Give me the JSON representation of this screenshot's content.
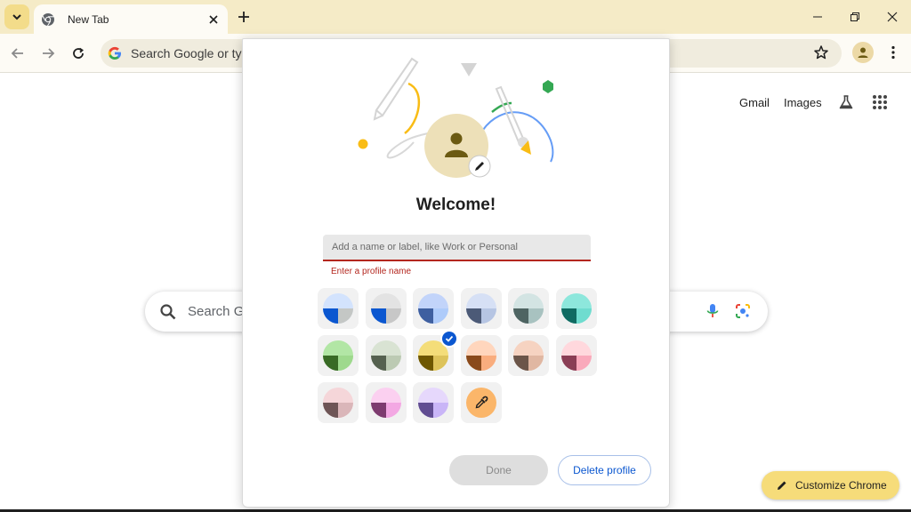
{
  "browser": {
    "tab_title": "New Tab",
    "omnibox_text": "Search Google or type",
    "accent_color": "#f5ebc7"
  },
  "ntp": {
    "links": [
      "Gmail",
      "Images"
    ],
    "search_placeholder": "Search G",
    "customize_label": "Customize Chrome"
  },
  "dialog": {
    "title": "Welcome!",
    "name_field": {
      "value": "",
      "placeholder": "Add a name or label, like Work or Personal"
    },
    "error_text": "Enter a profile name",
    "themes": [
      {
        "name": "theme-blue-1",
        "top": "#d3e3fd",
        "left": "#0b57d0",
        "right": "#c4c7c5"
      },
      {
        "name": "theme-grey-blue",
        "top": "#e3e3e3",
        "left": "#0b57d0",
        "right": "#c7c7c7"
      },
      {
        "name": "theme-blue-2",
        "top": "#c2d4fa",
        "left": "#3e5fa0",
        "right": "#aecbfa"
      },
      {
        "name": "theme-slate",
        "top": "#d6e0f5",
        "left": "#4c5a77",
        "right": "#b6c5e3"
      },
      {
        "name": "theme-grey-teal",
        "top": "#d3e4e3",
        "left": "#4e6462",
        "right": "#a8c2c0"
      },
      {
        "name": "theme-aqua",
        "top": "#8de7dc",
        "left": "#106b62",
        "right": "#6fdccf"
      },
      {
        "name": "theme-green",
        "top": "#b2e6a5",
        "left": "#386a25",
        "right": "#9ed98d"
      },
      {
        "name": "theme-sage",
        "top": "#d9e3d3",
        "left": "#55614f",
        "right": "#bccab3"
      },
      {
        "name": "theme-yellow",
        "top": "#f4dd79",
        "left": "#6e5700",
        "right": "#ddc35a"
      },
      {
        "name": "theme-orange",
        "top": "#ffd6bd",
        "left": "#8a4a1b",
        "right": "#f9ad7e"
      },
      {
        "name": "theme-tan",
        "top": "#f6d3c1",
        "left": "#6b5549",
        "right": "#e0b7a2"
      },
      {
        "name": "theme-pink",
        "top": "#ffd8dd",
        "left": "#8a3e55",
        "right": "#f9a9bb"
      },
      {
        "name": "theme-mauve",
        "top": "#f5d6d9",
        "left": "#6e5556",
        "right": "#dab6b9"
      },
      {
        "name": "theme-magenta",
        "top": "#fbd0f0",
        "left": "#7d3b6f",
        "right": "#f3a8e3"
      },
      {
        "name": "theme-lavender",
        "top": "#e6d8fc",
        "left": "#614d92",
        "right": "#c9b5f7"
      }
    ],
    "selected_theme": "theme-yellow",
    "done_label": "Done",
    "delete_label": "Delete profile"
  },
  "icons": {
    "tab_search": "chevron-down-icon",
    "favicon": "chrome-icon",
    "close": "close-icon",
    "new_tab": "plus-icon",
    "back": "arrow-back-icon",
    "forward": "arrow-forward-icon",
    "reload": "reload-icon",
    "bookmark": "star-icon",
    "profile": "person-icon",
    "menu": "more-vert-icon",
    "labs": "flask-icon",
    "apps": "apps-grid-icon",
    "mic": "mic-icon",
    "lens": "lens-icon",
    "pencil": "pencil-icon",
    "eyedropper": "eyedropper-icon"
  }
}
